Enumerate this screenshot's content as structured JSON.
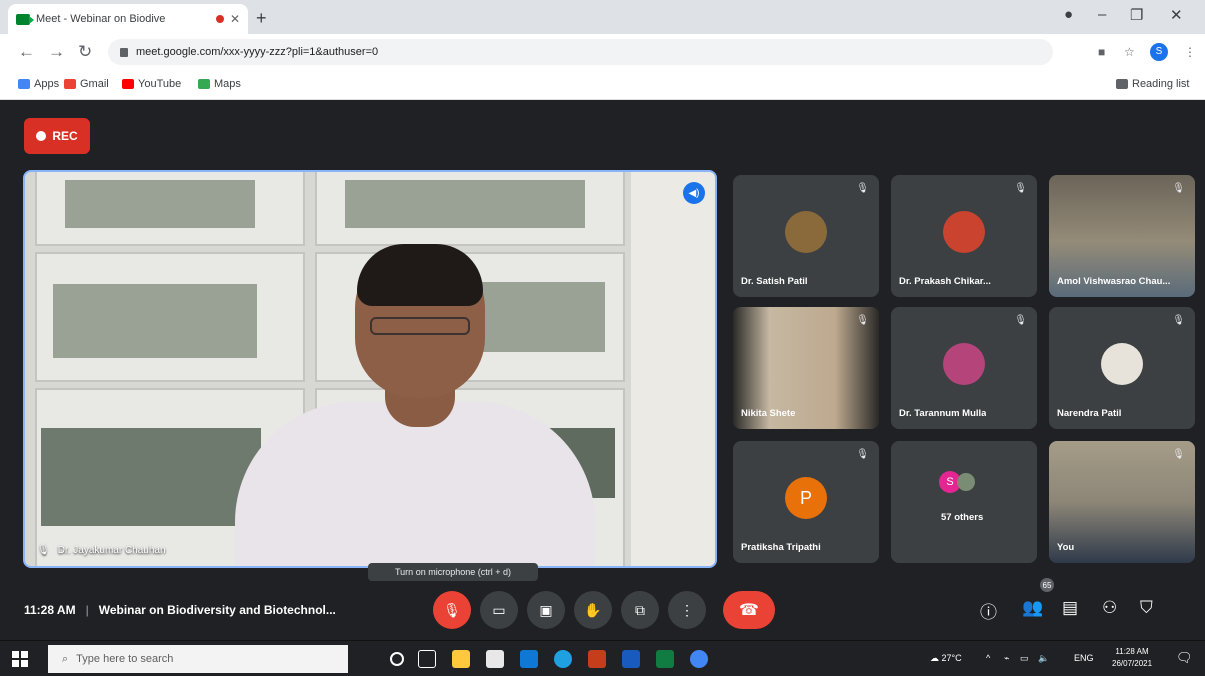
{
  "browser": {
    "tab_title": "Meet - Webinar on Biodive",
    "address": "meet.google.com/xxx-yyyy-zzz?pli=1&authuser=0",
    "bookmarks": [
      "Apps",
      "Gmail",
      "YouTube",
      "Maps"
    ],
    "reading_list": "Reading list",
    "profile_letter": "S"
  },
  "meet": {
    "rec_label": "REC",
    "main_speaker_name": "Dr. Jayakumar Chauhan",
    "tiles": [
      {
        "name": "Dr. Satish Patil",
        "type": "avatar",
        "color": "#8a6a3a"
      },
      {
        "name": "Dr. Prakash Chikar...",
        "type": "avatar",
        "color": "#c9432f"
      },
      {
        "name": "Amol Vishwasrao Chau...",
        "type": "video",
        "color": "#7f7a6d"
      },
      {
        "name": "Nikita Shete",
        "type": "video",
        "color": "#c6b8a2"
      },
      {
        "name": "Dr. Tarannum Mulla",
        "type": "avatar",
        "color": "#b5447a"
      },
      {
        "name": "Narendra Patil",
        "type": "avatar",
        "color": "#e7e3da"
      },
      {
        "name": "Pratiksha Tripathi",
        "type": "letter",
        "letter": "P"
      },
      {
        "name": "57 others",
        "type": "others",
        "letter": "S"
      },
      {
        "name": "You",
        "type": "video",
        "color": "#8d8677"
      }
    ],
    "tooltip": "Turn on microphone (ctrl + d)",
    "time": "11:28 AM",
    "meeting_title": "Webinar on Biodiversity and Biotechnol...",
    "participant_count": "65"
  },
  "taskbar": {
    "search_placeholder": "Type here to search",
    "weather": "27°C",
    "lang": "ENG",
    "time": "11:28 AM",
    "date": "26/07/2021"
  },
  "colors": {
    "meet_bg": "#202124",
    "tile_bg": "#3c4043",
    "accent_blue": "#8ab4f8",
    "danger_red": "#ea4335"
  }
}
